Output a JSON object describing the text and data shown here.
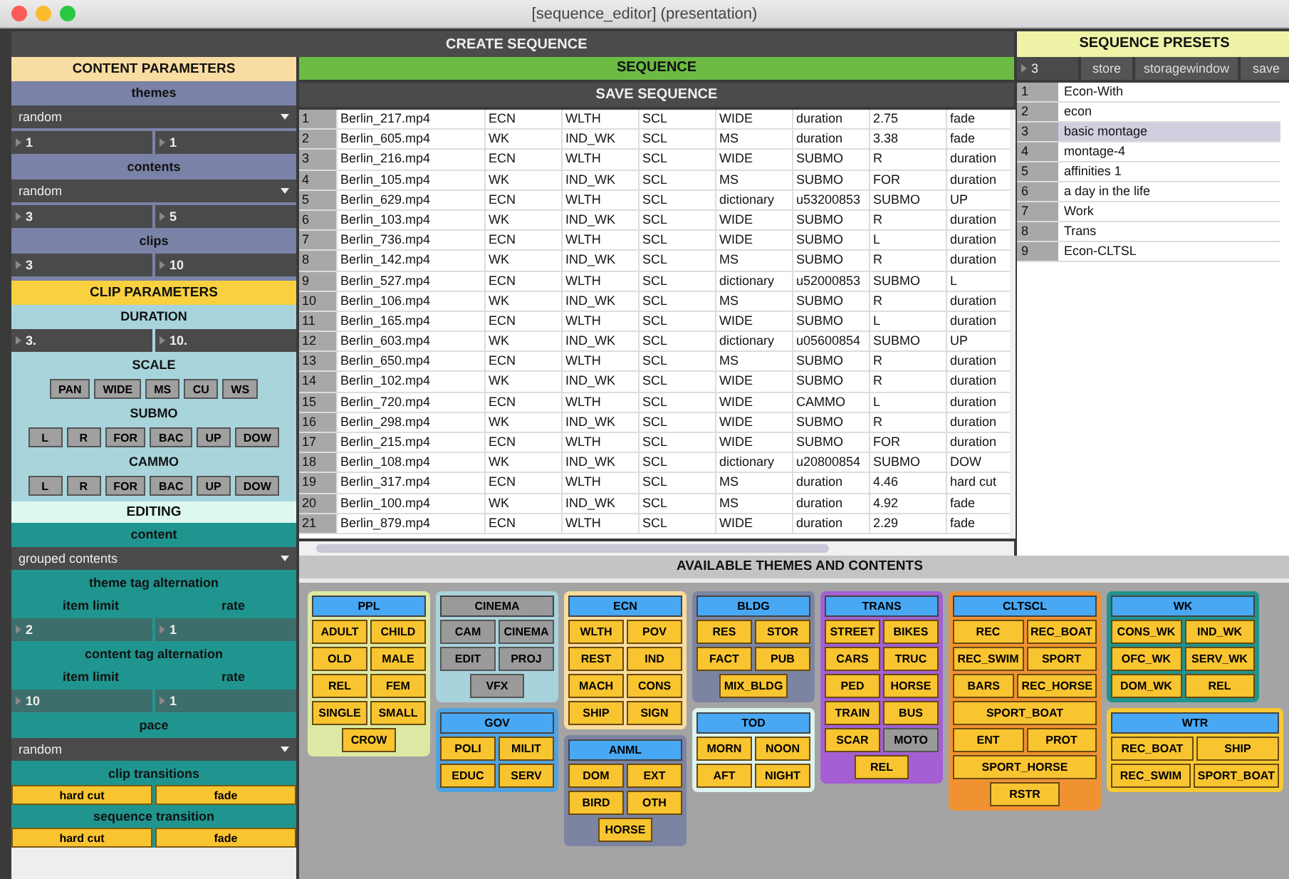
{
  "window": {
    "title": "[sequence_editor] (presentation)"
  },
  "create_sequence": {
    "label": "CREATE SEQUENCE"
  },
  "left_panels": [
    {
      "kind": "content",
      "title": "CONTENT PARAMETERS",
      "rows": [
        {
          "kind": "label",
          "text": "themes"
        },
        {
          "kind": "dropdown",
          "value": "random"
        },
        {
          "kind": "number_pair",
          "values": [
            "1",
            "1"
          ]
        },
        {
          "kind": "label",
          "text": "contents"
        },
        {
          "kind": "dropdown",
          "value": "random"
        },
        {
          "kind": "number_pair",
          "values": [
            "3",
            "5"
          ]
        },
        {
          "kind": "label",
          "text": "clips"
        },
        {
          "kind": "number_pair",
          "values": [
            "3",
            "10"
          ]
        }
      ]
    },
    {
      "kind": "clip",
      "title": "CLIP PARAMETERS",
      "rows": [
        {
          "kind": "label",
          "text": "DURATION"
        },
        {
          "kind": "number_pair",
          "values": [
            "3.",
            "10."
          ]
        },
        {
          "kind": "label",
          "text": "SCALE"
        },
        {
          "kind": "buttons",
          "labels": [
            "PAN",
            "WIDE",
            "MS",
            "CU",
            "WS"
          ]
        },
        {
          "kind": "label",
          "text": "SUBMO"
        },
        {
          "kind": "buttons",
          "labels": [
            "L",
            "R",
            "FOR",
            "BAC",
            "UP",
            "DOW"
          ]
        },
        {
          "kind": "label",
          "text": "CAMMO"
        },
        {
          "kind": "buttons",
          "labels": [
            "L",
            "R",
            "FOR",
            "BAC",
            "UP",
            "DOW"
          ]
        }
      ]
    },
    {
      "kind": "editing",
      "title": "EDITING",
      "rows": [
        {
          "kind": "label",
          "text": "content"
        },
        {
          "kind": "dropdown",
          "value": "grouped contents"
        },
        {
          "kind": "label",
          "text": "theme tag alternation"
        },
        {
          "kind": "label_pair",
          "labels": [
            "item limit",
            "rate"
          ]
        },
        {
          "kind": "number_pair",
          "values": [
            "2",
            "1"
          ]
        },
        {
          "kind": "label",
          "text": "content tag alternation"
        },
        {
          "kind": "label_pair",
          "labels": [
            "item limit",
            "rate"
          ]
        },
        {
          "kind": "number_pair",
          "values": [
            "10",
            "1"
          ]
        },
        {
          "kind": "label",
          "text": "pace"
        },
        {
          "kind": "dropdown",
          "value": "random"
        },
        {
          "kind": "label",
          "text": "clip transitions"
        },
        {
          "kind": "toggles",
          "labels": [
            "hard cut",
            "fade"
          ]
        },
        {
          "kind": "label",
          "text": "sequence transition"
        },
        {
          "kind": "toggles",
          "labels": [
            "hard cut",
            "fade"
          ]
        }
      ]
    }
  ],
  "sequence": {
    "title": "SEQUENCE",
    "save_label": "SAVE SEQUENCE",
    "rows": [
      {
        "n": "1",
        "cells": [
          "Berlin_217.mp4",
          "ECN",
          "WLTH",
          "SCL",
          "WIDE",
          "duration",
          "2.75",
          "fade"
        ]
      },
      {
        "n": "2",
        "cells": [
          "Berlin_605.mp4",
          "WK",
          "IND_WK",
          "SCL",
          "MS",
          "duration",
          "3.38",
          "fade"
        ]
      },
      {
        "n": "3",
        "cells": [
          "Berlin_216.mp4",
          "ECN",
          "WLTH",
          "SCL",
          "WIDE",
          "SUBMO",
          "R",
          "duration"
        ]
      },
      {
        "n": "4",
        "cells": [
          "Berlin_105.mp4",
          "WK",
          "IND_WK",
          "SCL",
          "MS",
          "SUBMO",
          "FOR",
          "duration"
        ]
      },
      {
        "n": "5",
        "cells": [
          "Berlin_629.mp4",
          "ECN",
          "WLTH",
          "SCL",
          "dictionary",
          "u53200853",
          "SUBMO",
          "UP"
        ]
      },
      {
        "n": "6",
        "cells": [
          "Berlin_103.mp4",
          "WK",
          "IND_WK",
          "SCL",
          "WIDE",
          "SUBMO",
          "R",
          "duration"
        ]
      },
      {
        "n": "7",
        "cells": [
          "Berlin_736.mp4",
          "ECN",
          "WLTH",
          "SCL",
          "WIDE",
          "SUBMO",
          "L",
          "duration"
        ]
      },
      {
        "n": "8",
        "cells": [
          "Berlin_142.mp4",
          "WK",
          "IND_WK",
          "SCL",
          "MS",
          "SUBMO",
          "R",
          "duration"
        ]
      },
      {
        "n": "9",
        "cells": [
          "Berlin_527.mp4",
          "ECN",
          "WLTH",
          "SCL",
          "dictionary",
          "u52000853",
          "SUBMO",
          "L"
        ]
      },
      {
        "n": "10",
        "cells": [
          "Berlin_106.mp4",
          "WK",
          "IND_WK",
          "SCL",
          "MS",
          "SUBMO",
          "R",
          "duration"
        ]
      },
      {
        "n": "11",
        "cells": [
          "Berlin_165.mp4",
          "ECN",
          "WLTH",
          "SCL",
          "WIDE",
          "SUBMO",
          "L",
          "duration"
        ]
      },
      {
        "n": "12",
        "cells": [
          "Berlin_603.mp4",
          "WK",
          "IND_WK",
          "SCL",
          "dictionary",
          "u05600854",
          "SUBMO",
          "UP"
        ]
      },
      {
        "n": "13",
        "cells": [
          "Berlin_650.mp4",
          "ECN",
          "WLTH",
          "SCL",
          "MS",
          "SUBMO",
          "R",
          "duration"
        ]
      },
      {
        "n": "14",
        "cells": [
          "Berlin_102.mp4",
          "WK",
          "IND_WK",
          "SCL",
          "WIDE",
          "SUBMO",
          "R",
          "duration"
        ]
      },
      {
        "n": "15",
        "cells": [
          "Berlin_720.mp4",
          "ECN",
          "WLTH",
          "SCL",
          "WIDE",
          "CAMMO",
          "L",
          "duration"
        ]
      },
      {
        "n": "16",
        "cells": [
          "Berlin_298.mp4",
          "WK",
          "IND_WK",
          "SCL",
          "WIDE",
          "SUBMO",
          "R",
          "duration"
        ]
      },
      {
        "n": "17",
        "cells": [
          "Berlin_215.mp4",
          "ECN",
          "WLTH",
          "SCL",
          "WIDE",
          "SUBMO",
          "FOR",
          "duration"
        ]
      },
      {
        "n": "18",
        "cells": [
          "Berlin_108.mp4",
          "WK",
          "IND_WK",
          "SCL",
          "dictionary",
          "u20800854",
          "SUBMO",
          "DOW"
        ]
      },
      {
        "n": "19",
        "cells": [
          "Berlin_317.mp4",
          "ECN",
          "WLTH",
          "SCL",
          "MS",
          "duration",
          "4.46",
          "hard cut"
        ]
      },
      {
        "n": "20",
        "cells": [
          "Berlin_100.mp4",
          "WK",
          "IND_WK",
          "SCL",
          "MS",
          "duration",
          "4.92",
          "fade"
        ]
      },
      {
        "n": "21",
        "cells": [
          "Berlin_879.mp4",
          "ECN",
          "WLTH",
          "SCL",
          "WIDE",
          "duration",
          "2.29",
          "fade"
        ]
      }
    ]
  },
  "presets": {
    "title": "SEQUENCE PRESETS",
    "number": "3",
    "buttons": [
      "store",
      "storagewindow",
      "save"
    ],
    "items": [
      {
        "n": "1",
        "name": "Econ-With",
        "selected": false
      },
      {
        "n": "2",
        "name": "econ",
        "selected": false
      },
      {
        "n": "3",
        "name": "basic montage",
        "selected": true
      },
      {
        "n": "4",
        "name": "montage-4",
        "selected": false
      },
      {
        "n": "5",
        "name": "affinities 1",
        "selected": false
      },
      {
        "n": "6",
        "name": "a day in the life",
        "selected": false
      },
      {
        "n": "7",
        "name": "Work",
        "selected": false
      },
      {
        "n": "8",
        "name": "Trans",
        "selected": false
      },
      {
        "n": "9",
        "name": "Econ-CLTSL",
        "selected": false
      }
    ]
  },
  "themes": {
    "title": "AVAILABLE THEMES AND CONTENTS",
    "columns": [
      {
        "groups": [
          {
            "name": "PPL",
            "color": "#dce9a4",
            "on": true,
            "items": [
              {
                "label": "ADULT",
                "on": true
              },
              {
                "label": "CHILD",
                "on": true
              },
              {
                "label": "OLD",
                "on": true
              },
              {
                "label": "MALE",
                "on": true
              },
              {
                "label": "REL",
                "on": true
              },
              {
                "label": "FEM",
                "on": true
              },
              {
                "label": "SINGLE",
                "on": true
              },
              {
                "label": "SMALL",
                "on": true
              },
              {
                "label": "CROW",
                "on": true
              }
            ]
          }
        ]
      },
      {
        "groups": [
          {
            "name": "CINEMA",
            "color": "#a9d3dc",
            "on": false,
            "items": [
              {
                "label": "CAM",
                "on": false
              },
              {
                "label": "CINEMA",
                "on": false
              },
              {
                "label": "EDIT",
                "on": false
              },
              {
                "label": "PROJ",
                "on": false
              },
              {
                "label": "VFX",
                "on": false
              }
            ]
          },
          {
            "name": "GOV",
            "color": "#4fa3e3",
            "on": true,
            "items": [
              {
                "label": "POLI",
                "on": true
              },
              {
                "label": "MILIT",
                "on": true
              },
              {
                "label": "EDUC",
                "on": true
              },
              {
                "label": "SERV",
                "on": true
              }
            ]
          }
        ]
      },
      {
        "groups": [
          {
            "name": "ECN",
            "color": "#f9dc9e",
            "on": true,
            "items": [
              {
                "label": "WLTH",
                "on": true
              },
              {
                "label": "POV",
                "on": true
              },
              {
                "label": "REST",
                "on": true
              },
              {
                "label": "IND",
                "on": true
              },
              {
                "label": "MACH",
                "on": true
              },
              {
                "label": "CONS",
                "on": true
              },
              {
                "label": "SHIP",
                "on": true
              },
              {
                "label": "SIGN",
                "on": true
              }
            ]
          },
          {
            "name": "ANML",
            "color": "#7c84a2",
            "on": true,
            "items": [
              {
                "label": "DOM",
                "on": true
              },
              {
                "label": "EXT",
                "on": true
              },
              {
                "label": "BIRD",
                "on": true
              },
              {
                "label": "OTH",
                "on": true
              },
              {
                "label": "HORSE",
                "on": true
              }
            ]
          }
        ]
      },
      {
        "groups": [
          {
            "name": "BLDG",
            "color": "#7c84a2",
            "on": true,
            "items": [
              {
                "label": "RES",
                "on": true
              },
              {
                "label": "STOR",
                "on": true
              },
              {
                "label": "FACT",
                "on": true
              },
              {
                "label": "PUB",
                "on": true
              },
              {
                "label": "MIX_BLDG",
                "on": true
              }
            ]
          },
          {
            "name": "TOD",
            "color": "#dcf3ee",
            "on": true,
            "items": [
              {
                "label": "MORN",
                "on": true
              },
              {
                "label": "NOON",
                "on": true
              },
              {
                "label": "AFT",
                "on": true
              },
              {
                "label": "NIGHT",
                "on": true
              }
            ]
          }
        ]
      },
      {
        "groups": [
          {
            "name": "TRANS",
            "color": "#a35fd3",
            "on": true,
            "items": [
              {
                "label": "STREET",
                "on": true
              },
              {
                "label": "BIKES",
                "on": true
              },
              {
                "label": "CARS",
                "on": true
              },
              {
                "label": "TRUC",
                "on": true
              },
              {
                "label": "PED",
                "on": true
              },
              {
                "label": "HORSE",
                "on": true
              },
              {
                "label": "TRAIN",
                "on": true
              },
              {
                "label": "BUS",
                "on": true
              },
              {
                "label": "SCAR",
                "on": true
              },
              {
                "label": "MOTO",
                "on": false
              },
              {
                "label": "REL",
                "on": true
              }
            ]
          }
        ]
      },
      {
        "groups": [
          {
            "name": "CLTSCL",
            "color": "#f09232",
            "on": true,
            "items": [
              {
                "label": "REC",
                "on": true
              },
              {
                "label": "REC_BOAT",
                "on": true
              },
              {
                "label": "REC_SWIM",
                "on": true
              },
              {
                "label": "SPORT",
                "on": true
              },
              {
                "label": "BARS",
                "on": true
              },
              {
                "label": "REC_HORSE",
                "on": true
              },
              {
                "label": "SPORT_BOAT",
                "on": true
              },
              {
                "label": "ENT",
                "on": true
              },
              {
                "label": "PROT",
                "on": true
              },
              {
                "label": "SPORT_HORSE",
                "on": true
              },
              {
                "label": "RSTR",
                "on": true
              }
            ]
          }
        ]
      },
      {
        "groups": [
          {
            "name": "WK",
            "color": "#21938d",
            "on": true,
            "items": [
              {
                "label": "CONS_WK",
                "on": true
              },
              {
                "label": "IND_WK",
                "on": true
              },
              {
                "label": "OFC_WK",
                "on": true
              },
              {
                "label": "SERV_WK",
                "on": true
              },
              {
                "label": "DOM_WK",
                "on": true
              },
              {
                "label": "REL",
                "on": true
              }
            ]
          },
          {
            "name": "WTR",
            "color": "#f6ca32",
            "on": true,
            "items": [
              {
                "label": "REC_BOAT",
                "on": true
              },
              {
                "label": "SHIP",
                "on": true
              },
              {
                "label": "REC_SWIM",
                "on": true
              },
              {
                "label": "SPORT_BOAT",
                "on": true
              }
            ]
          }
        ]
      }
    ]
  }
}
